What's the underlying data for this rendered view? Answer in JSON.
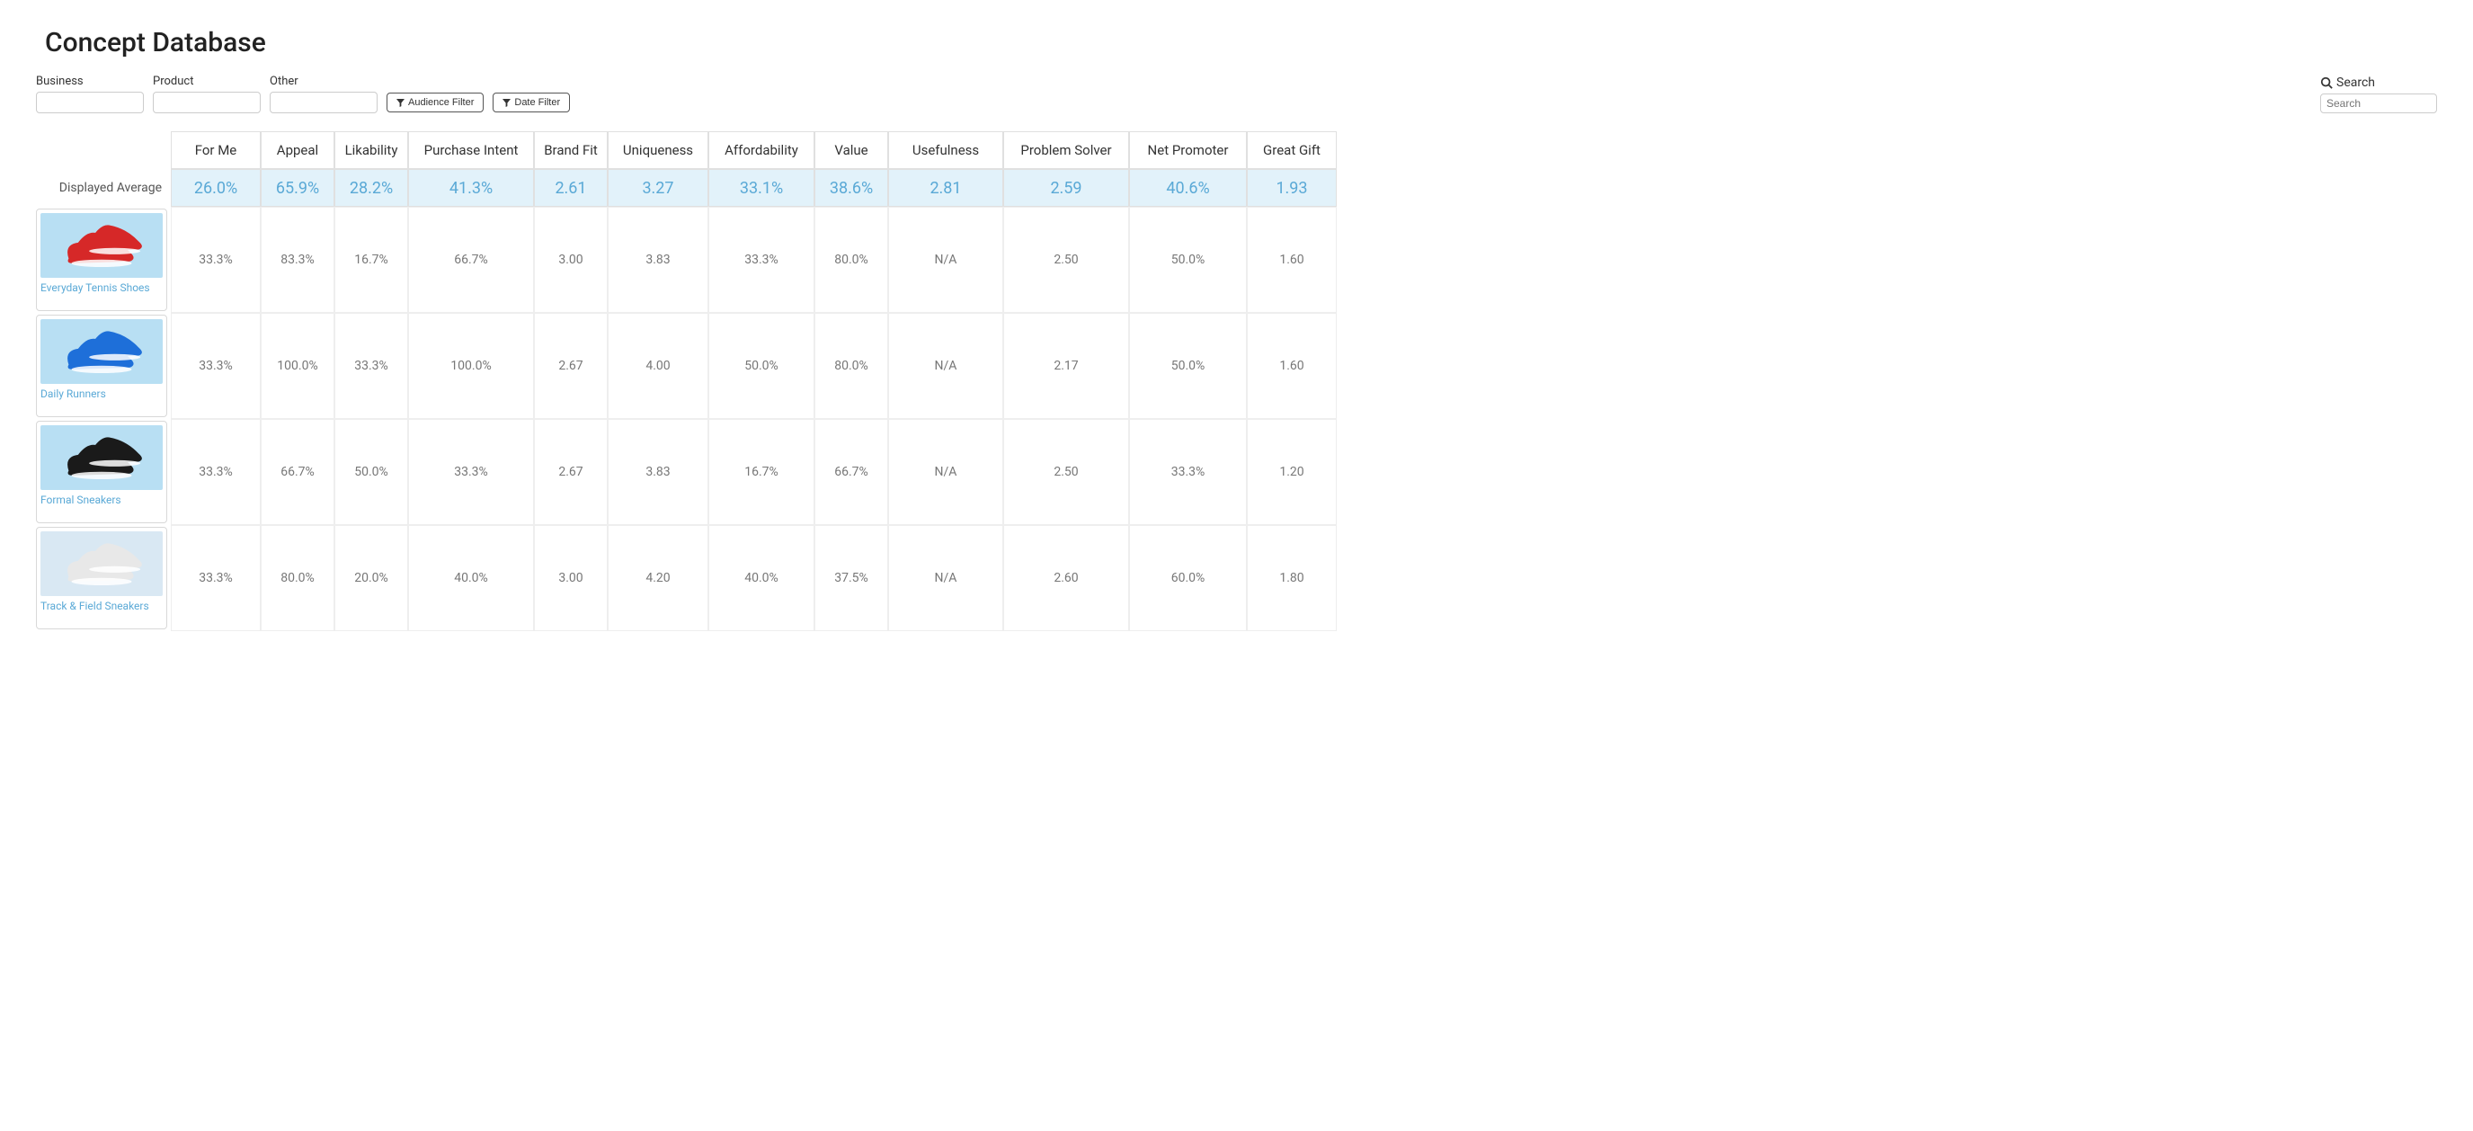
{
  "page_title": "Concept Database",
  "filters": {
    "business_label": "Business",
    "product_label": "Product",
    "other_label": "Other",
    "audience_filter_label": "Audience Filter",
    "date_filter_label": "Date Filter"
  },
  "search": {
    "label": "Search",
    "placeholder": "Search"
  },
  "columns": [
    "For Me",
    "Appeal",
    "Likability",
    "Purchase Intent",
    "Brand Fit",
    "Uniqueness",
    "Affordability",
    "Value",
    "Usefulness",
    "Problem Solver",
    "Net Promoter",
    "Great Gift"
  ],
  "avg_label": "Displayed Average",
  "averages": [
    "26.0%",
    "65.9%",
    "28.2%",
    "41.3%",
    "2.61",
    "3.27",
    "33.1%",
    "38.6%",
    "2.81",
    "2.59",
    "40.6%",
    "1.93"
  ],
  "concepts": [
    {
      "name": "Everyday Tennis Shoes",
      "img_colors": [
        "#b8dff3",
        "#d62828"
      ],
      "values": [
        "33.3%",
        "83.3%",
        "16.7%",
        "66.7%",
        "3.00",
        "3.83",
        "33.3%",
        "80.0%",
        "N/A",
        "2.50",
        "50.0%",
        "1.60"
      ]
    },
    {
      "name": "Daily Runners",
      "img_colors": [
        "#b8dff3",
        "#1e6fd9"
      ],
      "values": [
        "33.3%",
        "100.0%",
        "33.3%",
        "100.0%",
        "2.67",
        "4.00",
        "50.0%",
        "80.0%",
        "N/A",
        "2.17",
        "50.0%",
        "1.60"
      ]
    },
    {
      "name": "Formal Sneakers",
      "img_colors": [
        "#b8dff3",
        "#1a1a1a"
      ],
      "values": [
        "33.3%",
        "66.7%",
        "50.0%",
        "33.3%",
        "2.67",
        "3.83",
        "16.7%",
        "66.7%",
        "N/A",
        "2.50",
        "33.3%",
        "1.20"
      ]
    },
    {
      "name": "Track & Field Sneakers",
      "img_colors": [
        "#d9e8f3",
        "#e8e8e8"
      ],
      "values": [
        "33.3%",
        "80.0%",
        "20.0%",
        "40.0%",
        "3.00",
        "4.20",
        "40.0%",
        "37.5%",
        "N/A",
        "2.60",
        "60.0%",
        "1.80"
      ]
    }
  ]
}
